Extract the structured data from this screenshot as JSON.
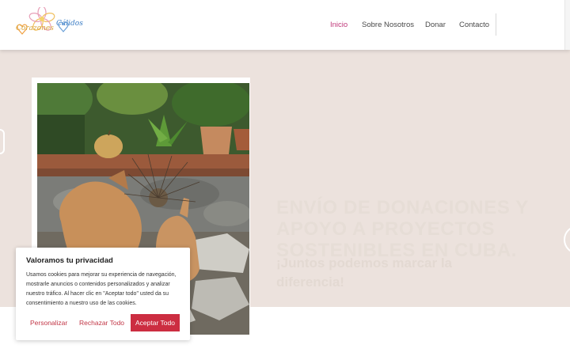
{
  "logo": {
    "word1": "Corazones",
    "word2": "Cálidos"
  },
  "nav": {
    "items": [
      {
        "label": "Inicio",
        "active": true
      },
      {
        "label": "Sobre Nosotros",
        "active": false
      },
      {
        "label": "Donar",
        "active": false
      },
      {
        "label": "Contacto",
        "active": false
      }
    ]
  },
  "hero": {
    "title": "ENVÍO DE DONACIONES Y APOYO A PROYECTOS SOSTENIBLES EN CUBA.",
    "subtitle": "¡Juntos podemos marcar la diferencia!"
  },
  "cookie": {
    "title": "Valoramos tu privacidad",
    "text": "Usamos cookies para mejorar su experiencia de navegación, mostrarle anuncios o contenidos personalizados y analizar nuestro tráfico. Al hacer clic en \"Aceptar todo\" usted da su consentimiento a nuestro uso de las cookies.",
    "customize_label": "Personalizar",
    "reject_label": "Rechazar Todo",
    "accept_label": "Aceptar Todo"
  },
  "colors": {
    "accent": "#c0397a",
    "hero_bg": "#ece2dd",
    "primary_button": "#cc2d41"
  }
}
